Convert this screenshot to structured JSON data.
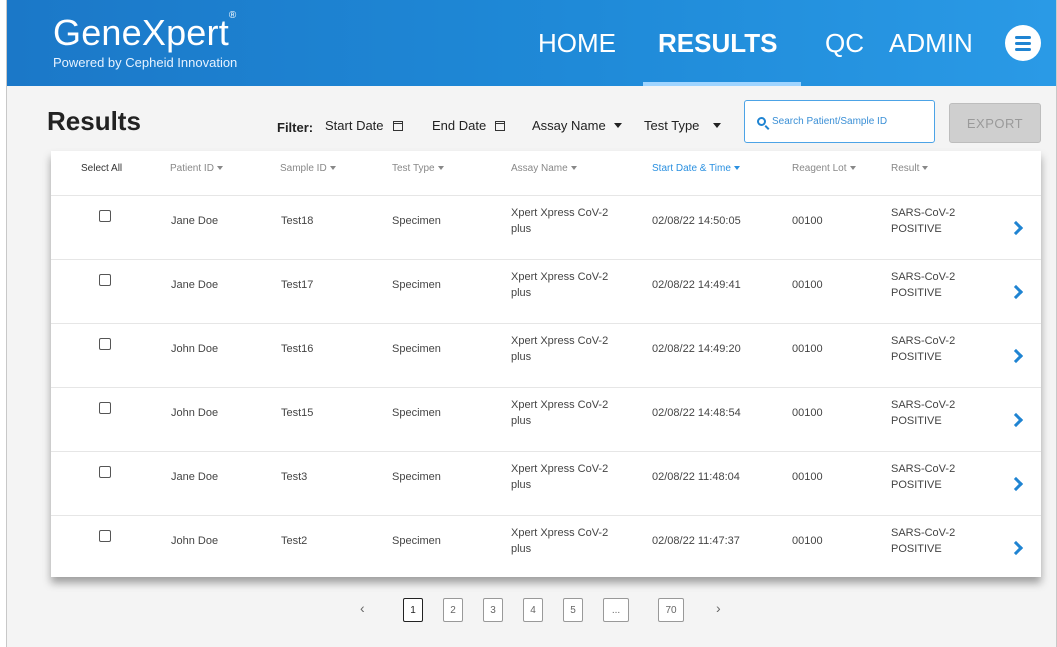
{
  "brand": {
    "name": "GeneXpert",
    "mark": "®",
    "tagline": "Powered by Cepheid Innovation"
  },
  "nav": {
    "items": [
      "HOME",
      "RESULTS",
      "QC",
      "ADMIN"
    ],
    "active": "RESULTS",
    "menu_icon": "menu-icon"
  },
  "toolbar": {
    "title": "Results",
    "filter_label": "Filter:",
    "start_date": "Start Date",
    "end_date": "End Date",
    "assay_name": "Assay Name",
    "test_type": "Test Type",
    "search_placeholder": "Search Patient/Sample ID",
    "export_label": "EXPORT"
  },
  "table": {
    "columns": [
      "Select All",
      "Patient ID",
      "Sample ID",
      "Test Type",
      "Assay Name",
      "Start Date & Time",
      "Reagent Lot",
      "Result"
    ],
    "sorted_column": "Start Date & Time",
    "rows": [
      {
        "patient": "Jane Doe",
        "sample": "Test18",
        "type": "Specimen",
        "assay_1": "Xpert Xpress CoV-2",
        "assay_2": "plus",
        "date": "02/08/22 14:50:05",
        "lot": "00100",
        "result_1": "SARS-CoV-2",
        "result_2": "POSITIVE"
      },
      {
        "patient": "Jane Doe",
        "sample": "Test17",
        "type": "Specimen",
        "assay_1": "Xpert Xpress CoV-2",
        "assay_2": "plus",
        "date": "02/08/22 14:49:41",
        "lot": "00100",
        "result_1": "SARS-CoV-2",
        "result_2": "POSITIVE"
      },
      {
        "patient": "John Doe",
        "sample": "Test16",
        "type": "Specimen",
        "assay_1": "Xpert Xpress CoV-2",
        "assay_2": "plus",
        "date": "02/08/22 14:49:20",
        "lot": "00100",
        "result_1": "SARS-CoV-2",
        "result_2": "POSITIVE"
      },
      {
        "patient": "John Doe",
        "sample": "Test15",
        "type": "Specimen",
        "assay_1": "Xpert Xpress CoV-2",
        "assay_2": "plus",
        "date": "02/08/22 14:48:54",
        "lot": "00100",
        "result_1": "SARS-CoV-2",
        "result_2": "POSITIVE"
      },
      {
        "patient": "Jane Doe",
        "sample": "Test3",
        "type": "Specimen",
        "assay_1": "Xpert Xpress CoV-2",
        "assay_2": "plus",
        "date": "02/08/22 11:48:04",
        "lot": "00100",
        "result_1": "SARS-CoV-2",
        "result_2": "POSITIVE"
      },
      {
        "patient": "John Doe",
        "sample": "Test2",
        "type": "Specimen",
        "assay_1": "Xpert Xpress CoV-2",
        "assay_2": "plus",
        "date": "02/08/22 11:47:37",
        "lot": "00100",
        "result_1": "SARS-CoV-2",
        "result_2": "POSITIVE"
      }
    ]
  },
  "pagination": {
    "prev": "‹",
    "next": "›",
    "pages": [
      "1",
      "2",
      "3",
      "4",
      "5",
      "...",
      "70"
    ],
    "current": "1"
  },
  "colors": {
    "header_blue": "#1f84d2",
    "accent": "#2a90e0",
    "export_disabled": "#cfcfcf"
  }
}
